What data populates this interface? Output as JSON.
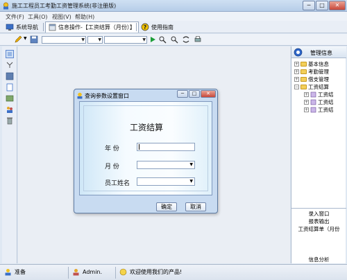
{
  "window": {
    "title": "施工工程员工考勤工资管理系统(非注册版)",
    "min_glyph": "─",
    "max_glyph": "□",
    "close_glyph": "✕"
  },
  "menu": [
    "文件(F)",
    "工具(O)",
    "视图(V)",
    "帮助(H)"
  ],
  "tabs": [
    {
      "label": "系统导航",
      "icon": "monitor-icon"
    },
    {
      "label": "信息操作-【工资结算（月份）】",
      "icon": "window-icon",
      "active": true
    },
    {
      "label": "使用指南",
      "icon": "help-icon"
    }
  ],
  "right_panel": {
    "title": "管理信息",
    "tree": [
      {
        "label": "基本信息",
        "level": 0
      },
      {
        "label": "考勤管理",
        "level": 0
      },
      {
        "label": "借支管理",
        "level": 0
      },
      {
        "label": "工资结算",
        "level": 0,
        "expanded": true
      },
      {
        "label": "工资结",
        "level": 1
      },
      {
        "label": "工资结",
        "level": 1
      },
      {
        "label": "工资结",
        "level": 1
      }
    ],
    "list": [
      "录入窗口",
      "报表输出",
      "工资结算单（月份",
      "信息分析"
    ]
  },
  "status": {
    "ready": "准备",
    "user": "Admin.",
    "welcome": "欢迎使用我们的产品!"
  },
  "dialog": {
    "title": "查询参数设置窗口",
    "heading": "工资结算",
    "fields": [
      {
        "label": "年    份",
        "value": "",
        "type": "text"
      },
      {
        "label": "月    份",
        "value": "",
        "type": "select"
      },
      {
        "label": "员工姓名",
        "value": "",
        "type": "select"
      }
    ],
    "ok": "确定",
    "cancel": "取消",
    "min_glyph": "─",
    "max_glyph": "□",
    "close_glyph": "✕"
  },
  "colors": {
    "accent": "#5d7aa2",
    "dialog_bg": "#c8dbf1",
    "folder": "#f3cf5a",
    "play": "#1e9e3a"
  }
}
